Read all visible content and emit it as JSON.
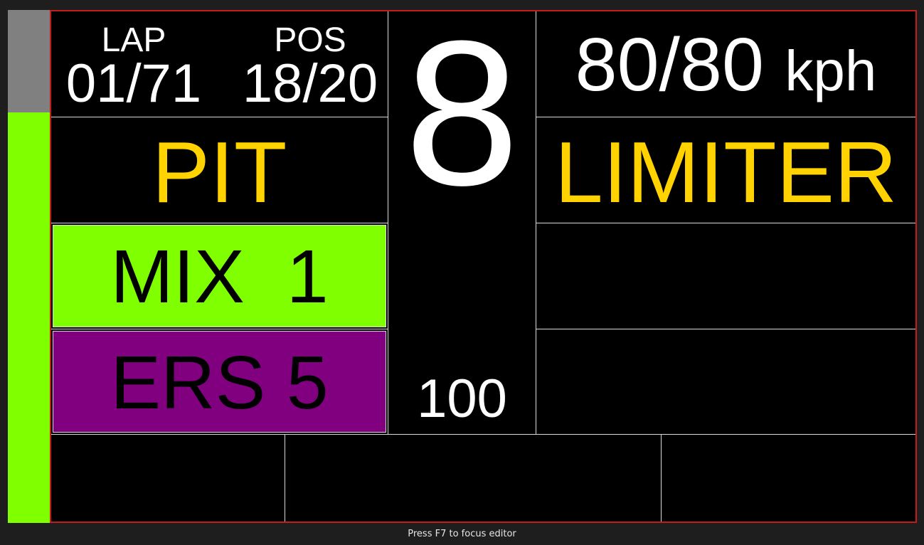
{
  "dashboard": {
    "lap": {
      "label": "LAP",
      "value": "01/71"
    },
    "position": {
      "label": "POS",
      "value": "18/20"
    },
    "gear": "8",
    "speed": {
      "value": "80/80",
      "unit": "kph"
    },
    "pit_text": "PIT",
    "limiter_text": "LIMITER",
    "mix": "MIX  1",
    "ers": "ERS 5",
    "lower_value": "100",
    "left_bar_level": 0.8
  },
  "colors": {
    "background": "#000000",
    "accent_yellow": "#ffd200",
    "mix_green": "#7fff00",
    "ers_purple": "#800080",
    "bar_green": "#7fff00",
    "bar_gray": "#808080",
    "outline_red": "#c41c1c"
  },
  "status_bar": {
    "text": "Press F7 to focus editor"
  }
}
